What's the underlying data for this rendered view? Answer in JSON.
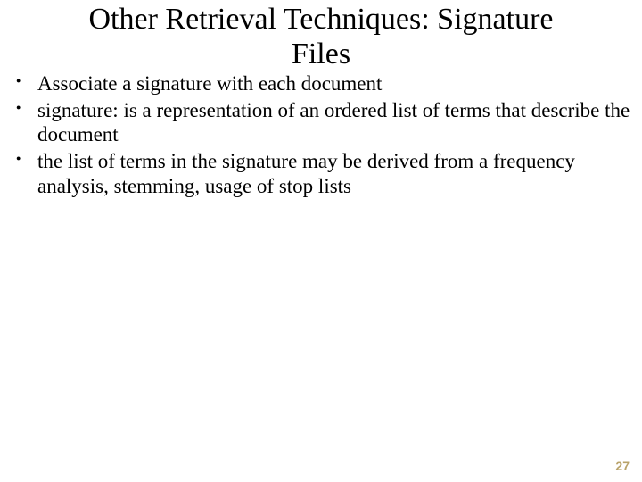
{
  "title_line1": "Other Retrieval Techniques: Signature",
  "title_line2": "Files",
  "bullets": {
    "b0": "Associate a signature with each document",
    "b1": "signature: is a representation of an ordered list of terms that describe the document",
    "b2": "the list of terms in the signature may be derived from a frequency analysis, stemming, usage of stop lists"
  },
  "page_number": "27"
}
